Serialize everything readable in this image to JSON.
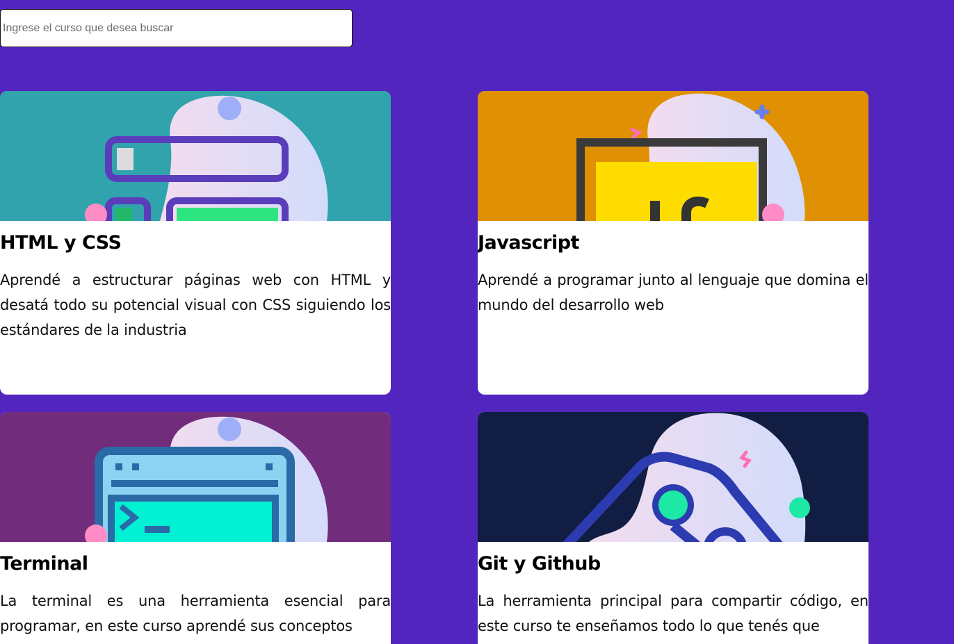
{
  "search": {
    "placeholder": "Ingrese el curso que desea buscar",
    "value": ""
  },
  "courses": [
    {
      "title": "HTML y CSS",
      "description": "Aprendé a estructurar páginas web con HTML y desatá todo su potencial visual con CSS siguiendo los estándares de la industria",
      "image_bg": "#31a3ac",
      "icon": "html-css-illustration-icon"
    },
    {
      "title": "Javascript",
      "description": "Aprendé a programar junto al lenguaje que domina el mundo del desarrollo web",
      "image_bg": "#df9003",
      "icon": "javascript-illustration-icon"
    },
    {
      "title": "Terminal",
      "description": "La terminal es una herramienta esencial para programar, en este curso aprendé sus conceptos",
      "image_bg": "#722c7c",
      "icon": "terminal-illustration-icon"
    },
    {
      "title": "Git y Github",
      "description": "La herramienta principal para compartir código, en este curso te enseñamos todo lo que tenés que",
      "image_bg": "#111d42",
      "icon": "git-illustration-icon"
    }
  ],
  "colors": {
    "page_bg": "#5225be",
    "card_bg": "#ffffff"
  }
}
